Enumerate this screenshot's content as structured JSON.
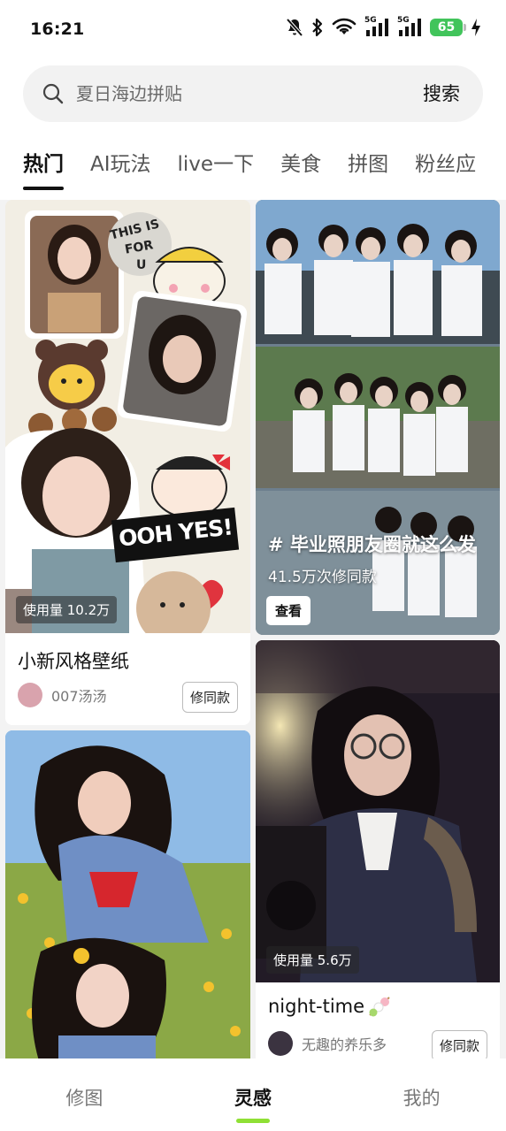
{
  "status": {
    "time": "16:21",
    "net1": "5G",
    "net2": "5G",
    "battery": "65",
    "icons": [
      "mute-icon",
      "bluetooth-icon",
      "wifi-icon",
      "signal-icon",
      "signal-icon",
      "battery-icon",
      "charging-icon"
    ]
  },
  "search": {
    "placeholder": "夏日海边拼贴",
    "button_label": "搜索"
  },
  "tabs": [
    {
      "label": "热门",
      "active": true
    },
    {
      "label": "AI玩法"
    },
    {
      "label": "live一下"
    },
    {
      "label": "美食"
    },
    {
      "label": "拼图"
    },
    {
      "label": "粉丝应"
    }
  ],
  "cards": {
    "crayon": {
      "usage": "使用量 10.2万",
      "title": "小新风格壁纸",
      "author": "007汤汤",
      "button": "修同款",
      "sticker_this": "THIS IS",
      "sticker_for": "FOR",
      "sticker_u": "U",
      "sticker_yes": "OOH YES!"
    },
    "graduation": {
      "hashtag": "# 毕业照朋友圈就这么发",
      "count": "41.5万次修同款",
      "button": "查看"
    },
    "night": {
      "usage": "使用量 5.6万",
      "title": "night-time",
      "author": "无趣的养乐多",
      "button": "修同款"
    }
  },
  "nav": {
    "items": [
      "修图",
      "灵感",
      "我的"
    ],
    "active_index": 1
  },
  "colors": {
    "accent": "#8fe035",
    "battery": "#41c45b"
  }
}
